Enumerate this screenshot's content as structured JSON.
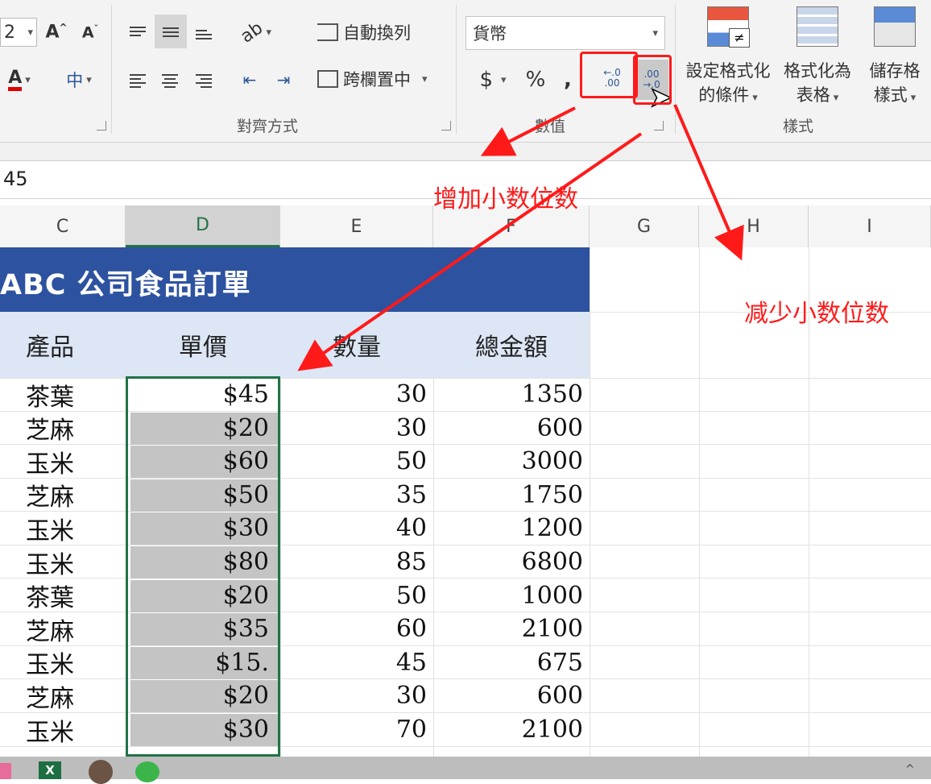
{
  "ribbon": {
    "font_size_value": "2",
    "wrap_text_label": "自動換列",
    "merge_center_label": "跨欄置中",
    "number_format_value": "貨幣",
    "currency_symbol": "$",
    "percent_symbol": "%",
    "comma_symbol": ",",
    "increase_decimal_glyph": "←.0 .00",
    "decrease_decimal_glyph": ".00 →.0",
    "conditional_format_label_1": "設定格式化",
    "conditional_format_label_2": "的條件",
    "format_as_table_label_1": "格式化為",
    "format_as_table_label_2": "表格",
    "cell_styles_label_1": "儲存格",
    "cell_styles_label_2": "樣式",
    "groups": {
      "alignment": "對齊方式",
      "number": "數值",
      "styles": "樣式"
    }
  },
  "formula_bar": {
    "value": "45"
  },
  "columns": [
    "C",
    "D",
    "E",
    "F",
    "G",
    "H",
    "I"
  ],
  "sheet": {
    "title": "ABC 公司食品訂單",
    "headers": [
      "產品",
      "單價",
      "數量",
      "總金額"
    ],
    "rows": [
      {
        "product": "茶葉",
        "price": "$45",
        "qty": "30",
        "total": "1350"
      },
      {
        "product": "芝麻",
        "price": "$20",
        "qty": "30",
        "total": "600"
      },
      {
        "product": "玉米",
        "price": "$60",
        "qty": "50",
        "total": "3000"
      },
      {
        "product": "芝麻",
        "price": "$50",
        "qty": "35",
        "total": "1750"
      },
      {
        "product": "玉米",
        "price": "$30",
        "qty": "40",
        "total": "1200"
      },
      {
        "product": "玉米",
        "price": "$80",
        "qty": "85",
        "total": "6800"
      },
      {
        "product": "茶葉",
        "price": "$20",
        "qty": "50",
        "total": "1000"
      },
      {
        "product": "芝麻",
        "price": "$35",
        "qty": "60",
        "total": "2100"
      },
      {
        "product": "玉米",
        "price": "$15.",
        "qty": "45",
        "total": "675"
      },
      {
        "product": "芝麻",
        "price": "$20",
        "qty": "30",
        "total": "600"
      },
      {
        "product": "玉米",
        "price": "$30",
        "qty": "70",
        "total": "2100"
      }
    ]
  },
  "annotations": {
    "increase_decimal": "增加小数位数",
    "decrease_decimal": "减少小数位数"
  },
  "colors": {
    "accent": "#217346",
    "title_band": "#2d52a0",
    "header_band": "#dce6f5",
    "annotation": "#ff1a1a"
  }
}
